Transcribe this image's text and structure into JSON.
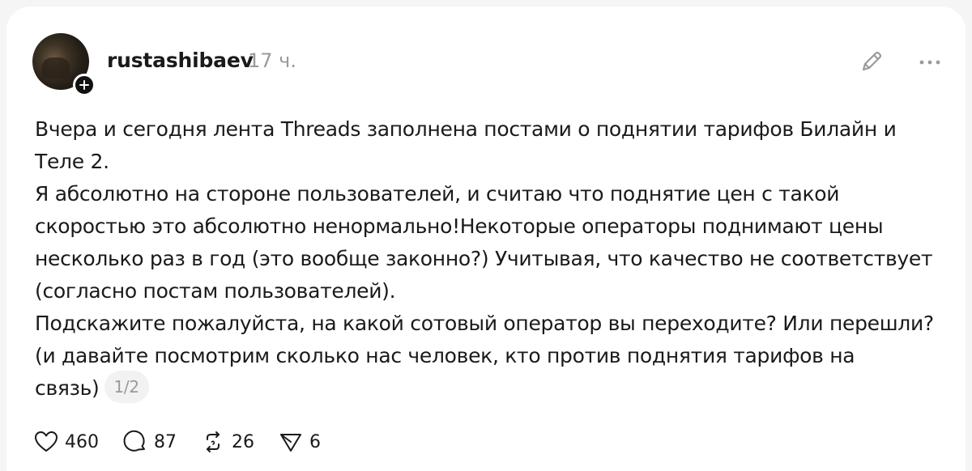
{
  "post": {
    "author": {
      "username": "rustashibaev",
      "avatar_icon": "user-avatar-photo",
      "follow_icon": "plus-icon"
    },
    "timestamp": "17 ч.",
    "header_icons": [
      "pencil-edit-icon",
      "more-options-icon"
    ],
    "lines": [
      "Вчера и сегодня лента Threads заполнена постами о поднятии тарифов Билайн и",
      "Теле 2.",
      "Я абсолютно на стороне пользователей, и считаю что поднятие цен с такой",
      "скоростью это абсолютно ненормально!Некоторые операторы поднимают цены",
      "несколько раз в год (это вообще законно?) Учитывая, что качество не соответствует",
      "(согласно постам пользователей).",
      "Подскажите пожалуйста, на какой сотовый оператор вы переходите? Или перешли?",
      "(и давайте посмотрим сколько нас человек, кто против поднятия тарифов на",
      "связь)"
    ],
    "page_indicator": "1/2",
    "actions": {
      "likes": "460",
      "comments": "87",
      "reposts": "26",
      "shares": "6"
    },
    "action_icons": [
      "heart-icon",
      "comment-icon",
      "repost-icon",
      "share-icon"
    ]
  }
}
